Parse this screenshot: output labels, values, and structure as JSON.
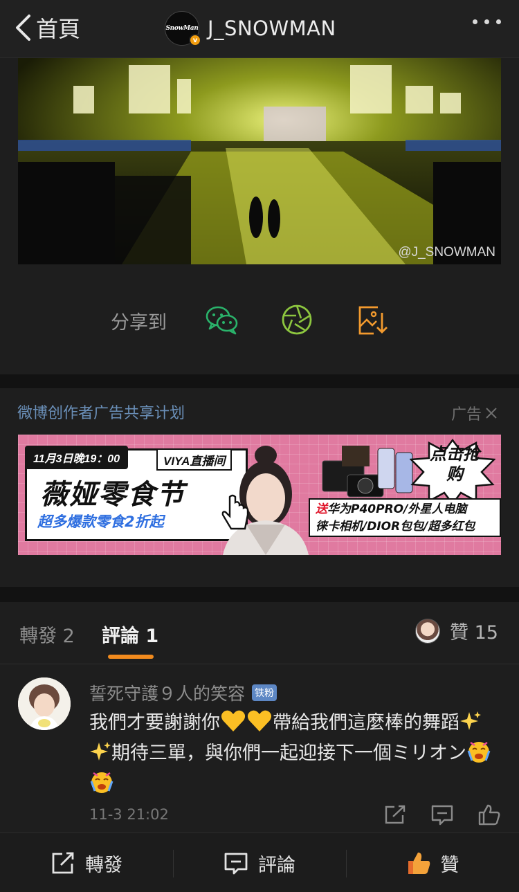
{
  "header": {
    "back_label": "首頁",
    "avatar_logo": "SnowMan",
    "title": "J_SNOWMAN"
  },
  "video": {
    "watermark": "@J_SNOWMAN"
  },
  "share": {
    "label": "分享到",
    "targets": [
      "wechat-icon",
      "moments-icon",
      "save-image-icon"
    ]
  },
  "ad": {
    "section_title": "微博创作者广告共享计划",
    "tag": "广告",
    "date": "11月3日晚19：00",
    "badge": "VIYA直播间",
    "headline": "薇娅零食节",
    "subline": "超多爆款零食2折起",
    "cta": "点击抢购",
    "gift_prefix": "送",
    "gift_line1": "华为P40PRO/外星人电脑",
    "gift_line2": "徕卡相机/DIOR包包/超多红包"
  },
  "tabs": {
    "repost": "轉發 2",
    "comment": "評論 1",
    "likes": "贊 15"
  },
  "comment": {
    "username": "誓死守護９人的笑容",
    "badge": "铁粉",
    "text_part1": "我們才要謝謝你",
    "text_part2": "帶給我們這麼棒的舞蹈",
    "text_part3": "期待三單，與你們一起迎接下一個ミリオン",
    "time": "11-3 21:02"
  },
  "bottom_bar": {
    "repost": "轉發",
    "comment": "評論",
    "like": "贊"
  },
  "colors": {
    "accent": "#f28b1e",
    "link_blue": "#6a8fb8",
    "background": "#1e1e1e",
    "wechat_green": "#2ab36b",
    "moments_green": "#8dc63f"
  }
}
